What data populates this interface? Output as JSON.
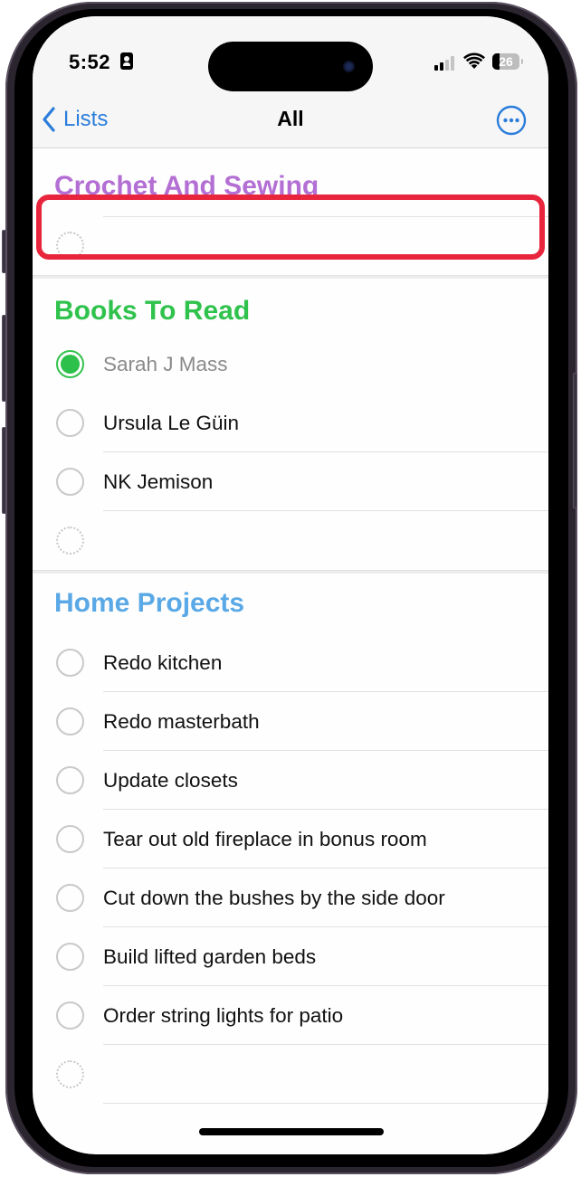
{
  "status_bar": {
    "time": "5:52",
    "battery_level": "26",
    "signal_bars_active": 2,
    "signal_bars_total": 4
  },
  "nav": {
    "back_label": "Lists",
    "title": "All"
  },
  "colors": {
    "accent": "#2b7ddb",
    "crochet": "#b36fd3",
    "books": "#2fc24c",
    "home": "#5aa9e6",
    "highlight": "#e8253c"
  },
  "sections": [
    {
      "title": "Crochet And Sewing",
      "items": []
    },
    {
      "title": "Books To Read",
      "items": [
        {
          "label": "Sarah J Mass",
          "completed": true
        },
        {
          "label": "Ursula Le Güin",
          "completed": false
        },
        {
          "label": "NK Jemison",
          "completed": false
        }
      ]
    },
    {
      "title": "Home Projects",
      "items": [
        {
          "label": "Redo kitchen",
          "completed": false
        },
        {
          "label": "Redo masterbath",
          "completed": false
        },
        {
          "label": "Update closets",
          "completed": false
        },
        {
          "label": "Tear out old fireplace in bonus room",
          "completed": false
        },
        {
          "label": "Cut down the bushes by the side door",
          "completed": false
        },
        {
          "label": "Build lifted garden beds",
          "completed": false
        },
        {
          "label": "Order string lights for patio",
          "completed": false
        }
      ]
    }
  ]
}
